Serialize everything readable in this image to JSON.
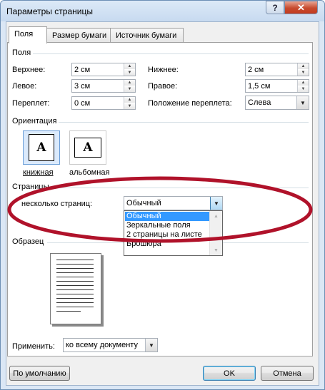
{
  "window": {
    "title": "Параметры страницы"
  },
  "titlebar": {
    "help_glyph": "?",
    "close_glyph": "✕"
  },
  "tabs": [
    {
      "label": "Поля"
    },
    {
      "label": "Размер бумаги"
    },
    {
      "label": "Источник бумаги"
    }
  ],
  "margins": {
    "group_label": "Поля",
    "top_label": "Верхнее:",
    "top_value": "2 см",
    "bottom_label": "Нижнее:",
    "bottom_value": "2 см",
    "left_label": "Левое:",
    "left_value": "3 см",
    "right_label": "Правое:",
    "right_value": "1,5 см",
    "gutter_label": "Переплет:",
    "gutter_value": "0 см",
    "gutter_pos_label": "Положение переплета:",
    "gutter_pos_value": "Слева"
  },
  "orientation": {
    "group_label": "Ориентация",
    "portrait_label": "книжная",
    "landscape_label": "альбомная",
    "icon_letter": "A"
  },
  "pages": {
    "group_label": "Страницы",
    "multiple_label": "несколько страниц:",
    "multiple_value": "Обычный",
    "options": [
      "Обычный",
      "Зеркальные поля",
      "2 страницы на листе",
      "Брошюра"
    ]
  },
  "preview": {
    "group_label": "Образец"
  },
  "apply": {
    "label": "Применить:",
    "value": "ко всему документу"
  },
  "buttons": {
    "default": "По умолчанию",
    "ok": "OK",
    "cancel": "Отмена"
  },
  "annotation": {
    "ellipse_color": "#b0122a"
  }
}
